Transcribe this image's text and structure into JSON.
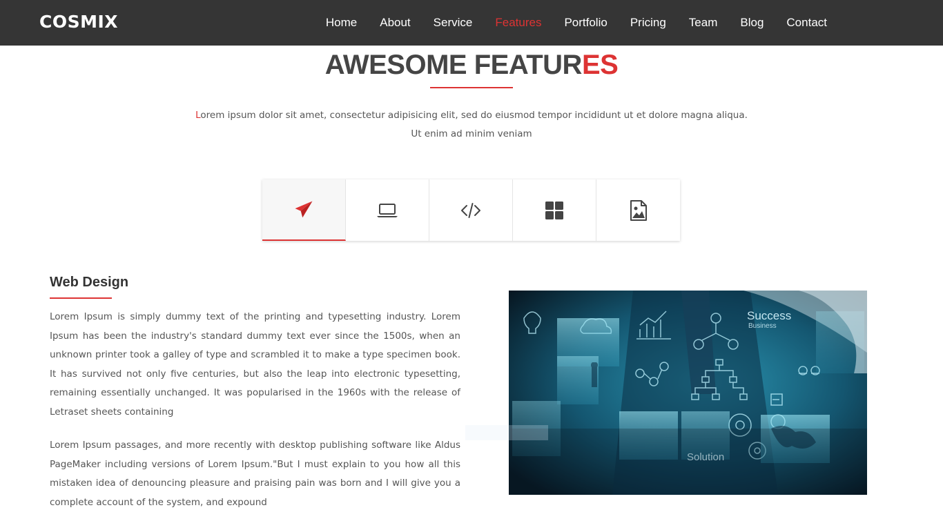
{
  "brand": "COSMIX",
  "nav": {
    "items": [
      {
        "label": "Home"
      },
      {
        "label": "About"
      },
      {
        "label": "Service"
      },
      {
        "label": "Features"
      },
      {
        "label": "Portfolio"
      },
      {
        "label": "Pricing"
      },
      {
        "label": "Team"
      },
      {
        "label": "Blog"
      },
      {
        "label": "Contact"
      }
    ],
    "active": "Features"
  },
  "section": {
    "title_main": "AWESOME FEATUR",
    "title_accent": "ES",
    "intro_first": "L",
    "intro_rest": "orem ipsum dolor sit amet, consectetur adipisicing elit, sed do eiusmod tempor incididunt ut et dolore magna aliqua.",
    "intro_line2": "Ut enim ad minim veniam"
  },
  "tabs": [
    {
      "icon": "paper-plane-icon",
      "active": true
    },
    {
      "icon": "laptop-icon",
      "active": false
    },
    {
      "icon": "code-icon",
      "active": false
    },
    {
      "icon": "grid-icon",
      "active": false
    },
    {
      "icon": "image-file-icon",
      "active": false
    }
  ],
  "content": {
    "title": "Web Design",
    "para1": "Lorem Ipsum is simply dummy text of the printing and typesetting industry. Lorem Ipsum has been the industry's standard dummy text ever since the 1500s, when an unknown printer took a galley of type and scrambled it to make a type specimen book. It has survived not only five centuries, but also the leap into electronic typesetting, remaining essentially unchanged. It was popularised in the 1960s with the release of Letraset sheets containing",
    "para2": "Lorem Ipsum passages, and more recently with desktop publishing software like Aldus PageMaker including versions of Lorem Ipsum.\"But I must explain to you how all this mistaken idea of denouncing pleasure and praising pain was born and I will give you a complete account of the system, and expound",
    "image_text_success": "Success",
    "image_text_business": "Business",
    "image_text_solution": "Solution"
  },
  "colors": {
    "accent": "#dd3333",
    "navbar": "#353535",
    "text": "#555555"
  }
}
